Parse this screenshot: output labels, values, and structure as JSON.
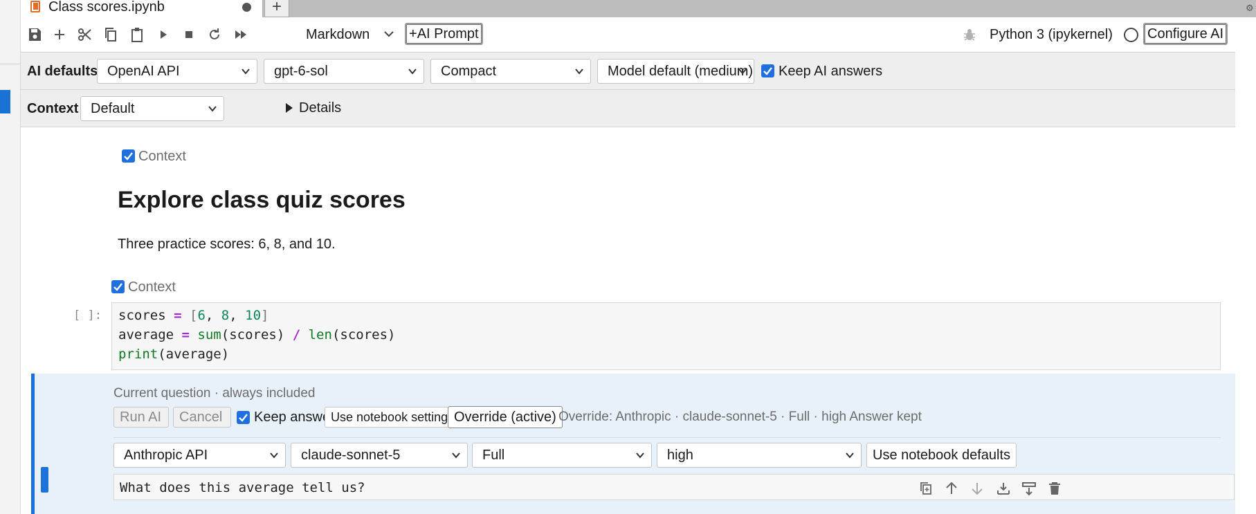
{
  "tab": {
    "title": "Class scores.ipynb",
    "new_tab": "+"
  },
  "toolbar": {
    "cell_type": "Markdown",
    "ai_prompt_label": "AI Prompt",
    "kernel_name": "Python 3 (ipykernel)",
    "configure_label": "Configure AI"
  },
  "ai_defaults": {
    "label": "AI defaults",
    "provider": "OpenAI API",
    "model": "gpt-6-sol",
    "context_mode": "Compact",
    "reasoning": "Model default (medium)",
    "keep_answers_label": "Keep AI answers",
    "keep_answers_checked": true
  },
  "context_bar": {
    "label": "Context",
    "selected": "Default",
    "details_label": "Details"
  },
  "markdown_cell": {
    "context_label": "Context",
    "context_checked": true,
    "heading": "Explore class quiz scores",
    "paragraph": "Three practice scores: 6, 8, and 10."
  },
  "code_cell": {
    "context_label": "Context",
    "context_checked": true,
    "prompt": "[ ]:",
    "lines": [
      "scores = [6, 8, 10]",
      "average = sum(scores) / len(scores)",
      "print(average)"
    ]
  },
  "ai_cell": {
    "status": "Current question · always included",
    "run_label": "Run AI",
    "cancel_label": "Cancel",
    "keep_label": "Keep answer",
    "keep_checked": true,
    "use_setting_label": "Use notebook setting",
    "override_label": "Override (active)",
    "override_summary": "Override: Anthropic · claude-sonnet-5 · Full · high",
    "answer_status": "Answer kept",
    "provider": "Anthropic API",
    "model": "claude-sonnet-5",
    "context_mode": "Full",
    "reasoning": "high",
    "use_defaults_label": "Use notebook defaults",
    "question": "What does this average tell us?"
  },
  "colors": {
    "accent": "#1c72d8",
    "checkbox": "#1f6fe0",
    "keyword": "#a626d9",
    "number": "#098658",
    "builtin": "#0b7a21",
    "notebook_icon": "#e06e2a"
  }
}
